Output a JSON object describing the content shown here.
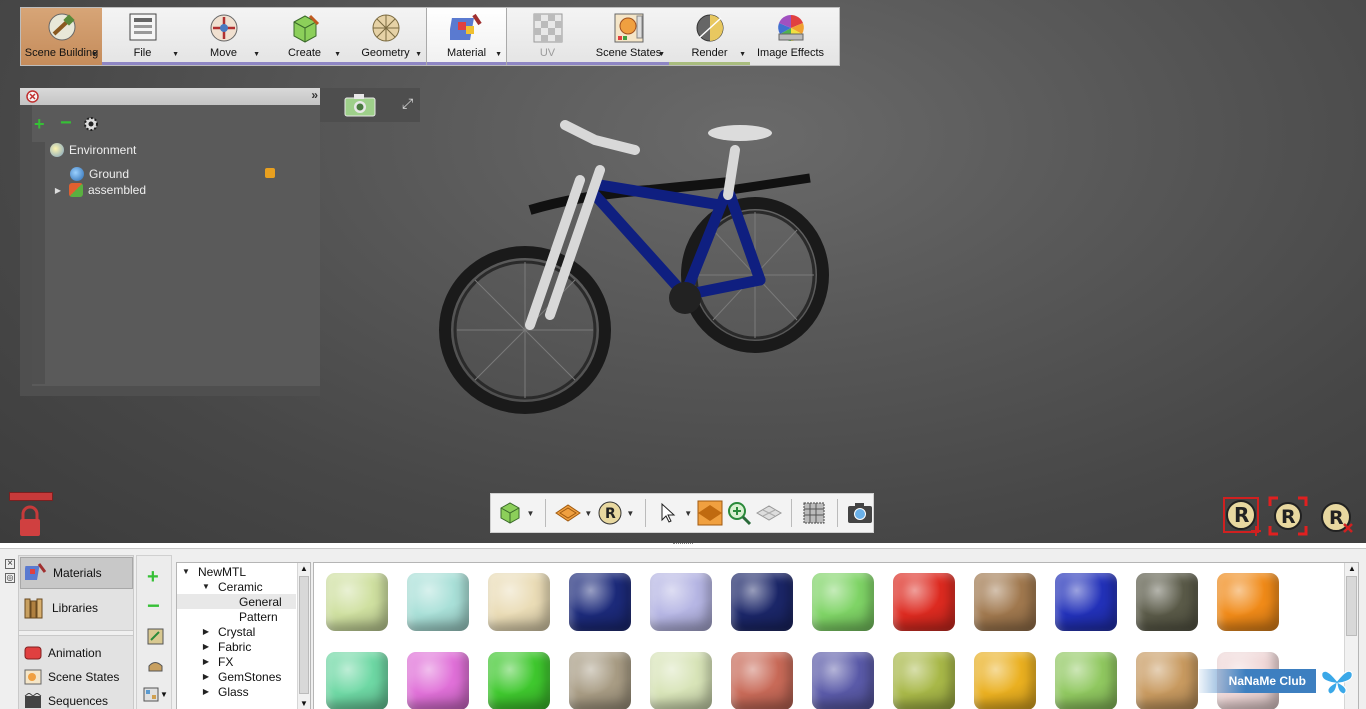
{
  "toolbar": {
    "items": [
      {
        "label": "Scene Building"
      },
      {
        "label": "File"
      },
      {
        "label": "Move"
      },
      {
        "label": "Create"
      },
      {
        "label": "Geometry"
      },
      {
        "label": "Material"
      },
      {
        "label": "UV"
      },
      {
        "label": "Scene States"
      },
      {
        "label": "Render"
      },
      {
        "label": "Image Effects"
      }
    ]
  },
  "scene_tree": {
    "root": "Environment",
    "items": [
      "Ground",
      "assembled"
    ]
  },
  "side_tabs": [
    "Materials",
    "Libraries",
    "Animation",
    "Scene States",
    "Sequences"
  ],
  "material_tree": {
    "rows": [
      {
        "label": "NewMTL",
        "depth": 0,
        "expanded": true
      },
      {
        "label": "Ceramic",
        "depth": 1,
        "expanded": true
      },
      {
        "label": "General",
        "depth": 2,
        "selected": true
      },
      {
        "label": "Pattern",
        "depth": 2
      },
      {
        "label": "Crystal",
        "depth": 1,
        "collapsed": true
      },
      {
        "label": "Fabric",
        "depth": 1,
        "collapsed": true
      },
      {
        "label": "FX",
        "depth": 1,
        "collapsed": true
      },
      {
        "label": "GemStones",
        "depth": 1,
        "collapsed": true
      },
      {
        "label": "Glass",
        "depth": 1,
        "collapsed": true
      }
    ]
  },
  "swatches": {
    "row1": [
      "#cfe0a0",
      "#a9e0d8",
      "#eadcb6",
      "#1c2a7a",
      "#b6b6e4",
      "#1b2668",
      "#7fd466",
      "#dd2a20",
      "#a0784e",
      "#2231b9",
      "#5a5a48",
      "#f08a18"
    ],
    "row2": [
      "#6ed8a4",
      "#e070d8",
      "#3fc82e",
      "#a89c84",
      "#d8e4b8",
      "#c86a58",
      "#5a5aa8",
      "#a8b848",
      "#eab020",
      "#90c860",
      "#c89a60",
      "#f0d8d8"
    ]
  },
  "watermark": {
    "text": "NaNaMe Club"
  }
}
